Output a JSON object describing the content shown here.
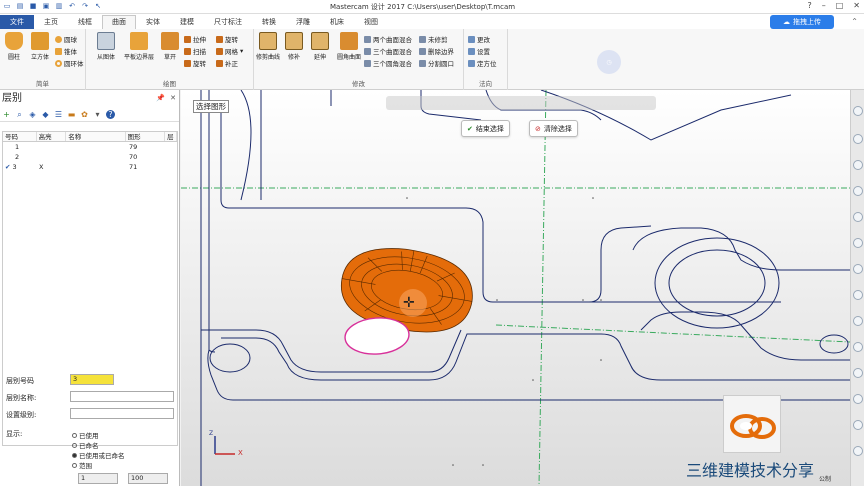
{
  "window": {
    "title": "Mastercam 设计 2017  C:\\Users\\user\\Desktop\\T.mcam",
    "controls": [
      "?",
      "–",
      "□",
      "✕"
    ]
  },
  "ribbon_tabs": [
    "文件",
    "主页",
    "线框",
    "曲面",
    "实体",
    "建模",
    "尺寸标注",
    "转换",
    "浮雕",
    "机床",
    "视图"
  ],
  "upload_button": "拖拽上传",
  "ribbon": {
    "groups": [
      {
        "label": "简单",
        "big": [
          "圆柱",
          "立方体"
        ],
        "small": [
          "圆球",
          "锥体",
          "圆环体"
        ]
      },
      {
        "label": "绘图",
        "big": [
          "从图体",
          "平板边界层",
          "草开"
        ],
        "small": [
          "拉伸",
          "旋转",
          "扫描",
          "网格",
          "旋转",
          "补正"
        ]
      },
      {
        "label": "修改",
        "big": [
          "修剪曲线",
          "修补",
          "延伸",
          "圆角曲面"
        ],
        "small": [
          "两个曲面混合",
          "三个曲面混合",
          "三个圆角混合",
          "未修剪",
          "删除边界",
          "分割圆口"
        ]
      },
      {
        "label": "法向",
        "small": [
          "更改",
          "设置",
          "定方位"
        ]
      }
    ]
  },
  "levels_panel": {
    "title": "层别",
    "columns": [
      "号码",
      "高亮",
      "名称",
      "图形",
      "层"
    ],
    "rows": [
      {
        "number": "1",
        "highlight": "",
        "name": "",
        "entities": "79",
        "current": false
      },
      {
        "number": "2",
        "highlight": "",
        "name": "",
        "entities": "70",
        "current": false
      },
      {
        "number": "3",
        "highlight": "X",
        "name": "",
        "entities": "71",
        "current": true
      }
    ],
    "fields": {
      "number_label": "层别号码",
      "number_value": "3",
      "name_label": "层别名称:",
      "name_value": "",
      "set_label": "设置级别:",
      "set_value": ""
    },
    "display_label": "显示:",
    "display_options": [
      {
        "label": "已使用",
        "selected": false
      },
      {
        "label": "已命名",
        "selected": false
      },
      {
        "label": "已使用或已命名",
        "selected": true
      },
      {
        "label": "范围",
        "selected": false
      }
    ],
    "range_from": "1",
    "range_to": "100"
  },
  "viewport": {
    "prompt": "选择图形",
    "buttons": {
      "finish": "结束选择",
      "clear": "清除选择"
    },
    "watermark": "三维建模技术分享",
    "watermark_sub": "公制",
    "axis_labels": {
      "x": "X",
      "z": "Z"
    },
    "colors": {
      "surface": "#e46c0a",
      "wire": "#1b2a6b",
      "axis_green": "#3aaa5e"
    }
  }
}
